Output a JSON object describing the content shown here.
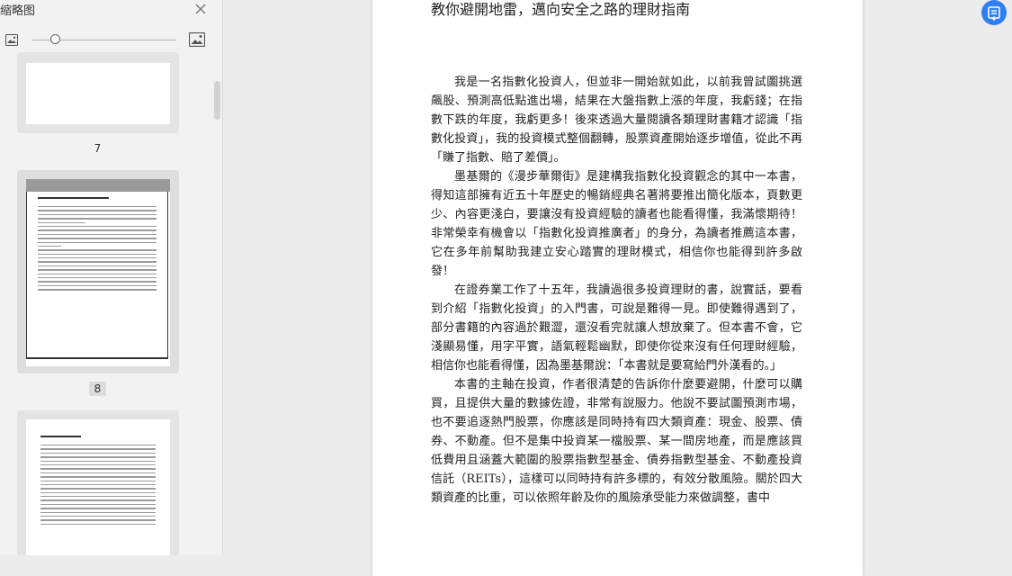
{
  "sidebar": {
    "title": "缩略图",
    "thumbnails": [
      {
        "page": "7",
        "selected": false
      },
      {
        "page": "8",
        "selected": true
      },
      {
        "page": "",
        "selected": false
      }
    ]
  },
  "document": {
    "title": "教你避開地雷，邁向安全之路的理財指南",
    "paragraphs": [
      "我是一名指數化投資人，但並非一開始就如此，以前我曾試圖挑選飆股、預測高低點進出場，結果在大盤指數上漲的年度，我虧錢；在指數下跌的年度，我虧更多！後來透過大量閱讀各類理財書籍才認識「指數化投資」，我的投資模式整個翻轉，股票資產開始逐步增值，從此不再「賺了指數、賠了差價」。",
      "墨基爾的《漫步華爾街》是建構我指數化投資觀念的其中一本書，得知這部擁有近五十年歷史的暢銷經典名著將要推出簡化版本，頁數更少、內容更淺白，要讓沒有投資經驗的讀者也能看得懂，我滿懷期待！非常榮幸有機會以「指數化投資推廣者」的身分，為讀者推薦這本書，它在多年前幫助我建立安心踏實的理財模式，相信你也能得到許多啟發！",
      "在證券業工作了十五年，我讀過很多投資理財的書，說實話，要看到介紹「指數化投資」的入門書，可說是難得一見。即使難得遇到了，部分書籍的內容過於艱澀，還沒看完就讓人想放棄了。但本書不會，它淺顯易懂，用字平實，語氣輕鬆幽默，即使你從來沒有任何理財經驗，相信你也能看得懂，因為墨基爾說：「本書就是要寫給門外漢看的。」",
      "本書的主軸在投資，作者很清楚的告訴你什麼要避開，什麼可以購買，且提供大量的數據佐證，非常有說服力。他說不要試圖預測市場，也不要追逐熱門股票，你應該是同時持有四大類資產：現金、股票、債券、不動產。但不是集中投資某一檔股票、某一間房地產，而是應該買低費用且涵蓋大範圍的股票指數型基金、債券指數型基金、不動產投資信託（REITs），這樣可以同時持有許多標的，有效分散風險。關於四大類資產的比重，可以依照年齡及你的風險承受能力來做調整，書中"
    ]
  },
  "icons": {
    "close": "close-icon",
    "zoom_small": "image-small-icon",
    "zoom_large": "image-large-icon",
    "float": "convert-document-icon"
  },
  "colors": {
    "accent": "#2f7ef5",
    "sidebar_bg": "#f2f2f2",
    "workspace_bg": "#ececec"
  }
}
